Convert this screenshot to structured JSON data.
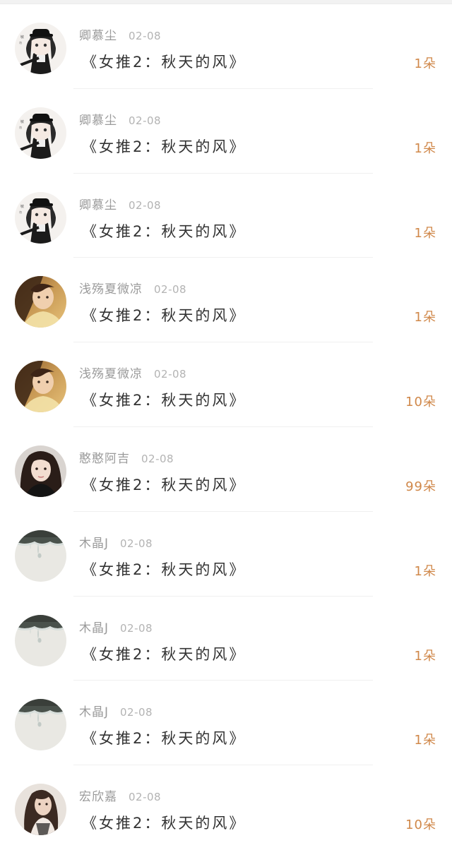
{
  "colors": {
    "accent_amount": "#d0884a",
    "name_gray": "#9a9a9a",
    "title_dark": "#333333"
  },
  "gifts": [
    {
      "avatar": "anime-girl-cap-avatar",
      "user": "卿慕尘",
      "date": "02-08",
      "title": "《女推2：秋天的风》",
      "amount": "1朵"
    },
    {
      "avatar": "anime-girl-cap-avatar",
      "user": "卿慕尘",
      "date": "02-08",
      "title": "《女推2：秋天的风》",
      "amount": "1朵"
    },
    {
      "avatar": "anime-girl-cap-avatar",
      "user": "卿慕尘",
      "date": "02-08",
      "title": "《女推2：秋天的风》",
      "amount": "1朵"
    },
    {
      "avatar": "warm-selfie-avatar",
      "user": "浅殇夏微凉",
      "date": "02-08",
      "title": "《女推2：秋天的风》",
      "amount": "1朵"
    },
    {
      "avatar": "warm-selfie-avatar",
      "user": "浅殇夏微凉",
      "date": "02-08",
      "title": "《女推2：秋天的风》",
      "amount": "10朵"
    },
    {
      "avatar": "dark-hair-girl-avatar",
      "user": "憨憨阿吉",
      "date": "02-08",
      "title": "《女推2：秋天的风》",
      "amount": "99朵"
    },
    {
      "avatar": "water-drop-avatar",
      "user": "木晶J",
      "date": "02-08",
      "title": "《女推2：秋天的风》",
      "amount": "1朵"
    },
    {
      "avatar": "water-drop-avatar",
      "user": "木晶J",
      "date": "02-08",
      "title": "《女推2：秋天的风》",
      "amount": "1朵"
    },
    {
      "avatar": "water-drop-avatar",
      "user": "木晶J",
      "date": "02-08",
      "title": "《女推2：秋天的风》",
      "amount": "1朵"
    },
    {
      "avatar": "long-hair-woman-avatar",
      "user": "宏欣嘉",
      "date": "02-08",
      "title": "《女推2：秋天的风》",
      "amount": "10朵"
    }
  ]
}
